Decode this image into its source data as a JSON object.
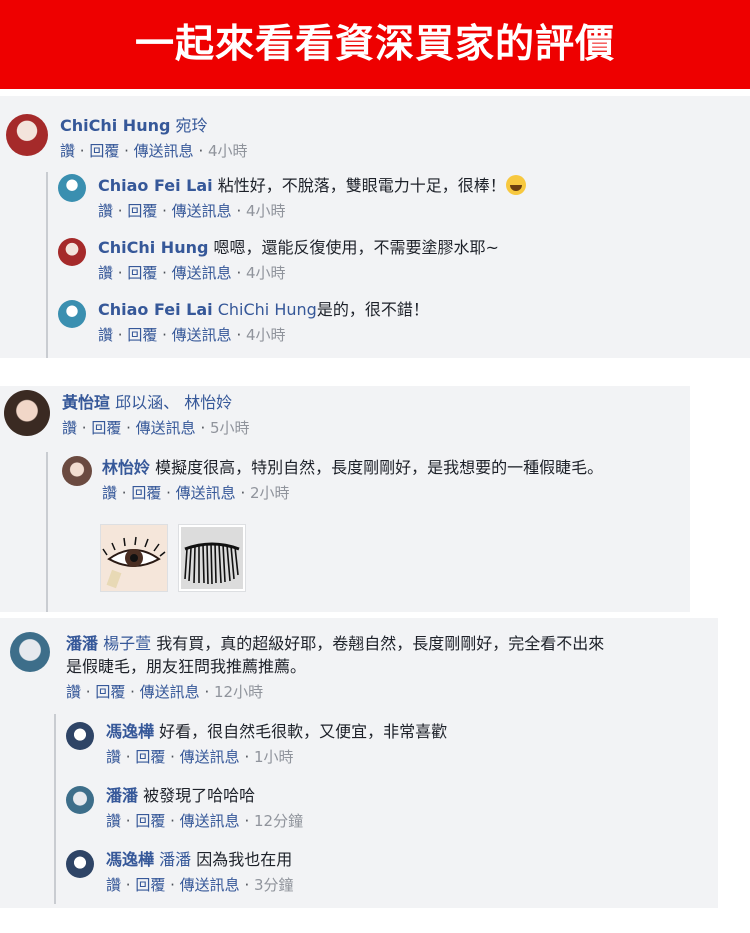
{
  "banner": {
    "title": "一起來看看資深買家的評價"
  },
  "actions": {
    "like": "讚",
    "reply": "回覆",
    "send": "傳送訊息",
    "sep": " · "
  },
  "block1": {
    "main": {
      "name": "ChiChi Hung",
      "tag": "宛玲",
      "text": "",
      "time": "4小時"
    },
    "replies": [
      {
        "name": "Chiao Fei Lai",
        "tag": "",
        "text": "粘性好，不脫落，雙眼電力十足，很棒！",
        "time": "4小時",
        "emoji": "laughing-emoji"
      },
      {
        "name": "ChiChi Hung",
        "tag": "",
        "text": "嗯嗯，還能反復使用，不需要塗膠水耶~",
        "time": "4小時"
      },
      {
        "name": "Chiao Fei Lai",
        "tag": "ChiChi Hung",
        "text": "是的，很不錯！",
        "time": "4小時"
      }
    ]
  },
  "block2": {
    "main": {
      "name": "黃怡瑄",
      "tag": "邱以涵、 林怡姈",
      "text": "",
      "time": "5小時"
    },
    "reply": {
      "name": "林怡姈",
      "tag": "",
      "text": "模擬度很高，特別自然，長度剛剛好，是我想要的一種假睫毛。",
      "time": "2小時"
    },
    "photos": [
      "eye-closeup-photo",
      "false-eyelash-photo"
    ]
  },
  "block3": {
    "main": {
      "name": "潘潘",
      "tag": "楊子萱",
      "text_line1": "我有買，真的超級好耶，卷翹自然，長度剛剛好，完全看不出來",
      "text_line2": "是假睫毛，朋友狂問我推薦推薦。",
      "time": "12小時"
    },
    "replies": [
      {
        "name": "馮逸樺",
        "tag": "",
        "text": "好看，很自然毛很軟，又便宜，非常喜歡",
        "time": "1小時"
      },
      {
        "name": "潘潘",
        "tag": "",
        "text": "被發現了哈哈哈",
        "time": "12分鐘"
      },
      {
        "name": "馮逸樺",
        "tag": "潘潘",
        "text": "因為我也在用",
        "time": "3分鐘"
      }
    ]
  },
  "colors": {
    "banner": "#ee0000",
    "name": "#365899",
    "block_bg": "#f2f3f5"
  }
}
